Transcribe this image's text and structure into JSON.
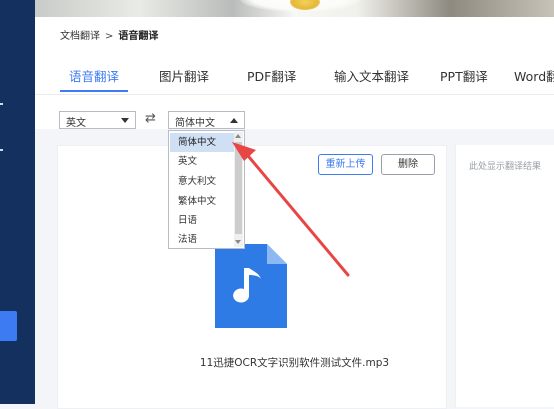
{
  "breadcrumb": {
    "root": "文档翻译",
    "separator": ">",
    "current": "语音翻译"
  },
  "tabs": [
    {
      "label": "语音翻译",
      "active": true
    },
    {
      "label": "图片翻译",
      "active": false
    },
    {
      "label": "PDF翻译",
      "active": false
    },
    {
      "label": "输入文本翻译",
      "active": false
    },
    {
      "label": "PPT翻译",
      "active": false
    },
    {
      "label": "Word翻",
      "active": false
    }
  ],
  "source_lang": {
    "value": "英文"
  },
  "swap_icon": "swap-arrows-icon",
  "target_lang": {
    "value": "简体中文",
    "options": [
      "简体中文",
      "英文",
      "意大利文",
      "繁体中文",
      "日语",
      "法语"
    ],
    "highlighted": "简体中文"
  },
  "buttons": {
    "reupload": "重新上传",
    "delete": "删除"
  },
  "result_placeholder": "此处显示翻译结果",
  "file": {
    "icon": "audio-file-icon",
    "name": "11迅捷OCR文字识别软件测试文件.mp3"
  },
  "colors": {
    "accent": "#3d7bf2",
    "sidebar": "#14305e",
    "annotation": "#e84545"
  }
}
